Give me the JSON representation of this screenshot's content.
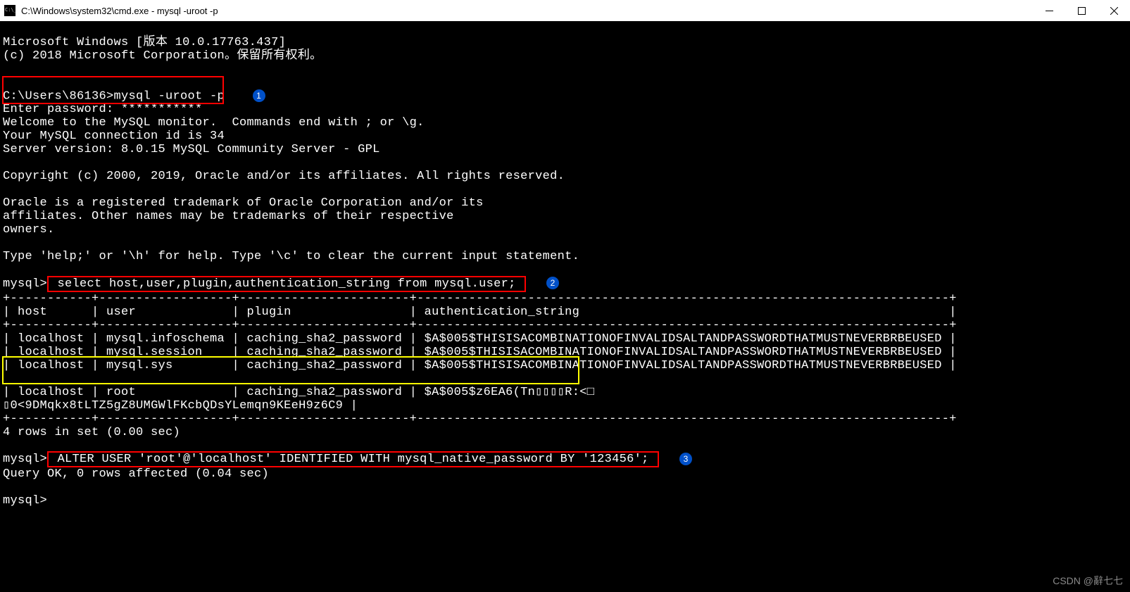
{
  "titlebar": {
    "title": "C:\\Windows\\system32\\cmd.exe - mysql  -uroot -p"
  },
  "term": {
    "winver1": "Microsoft Windows [版本 10.0.17763.437]",
    "winver2": "(c) 2018 Microsoft Corporation。保留所有权利。",
    "prompt1a": "C:\\Users\\86136>",
    "prompt1b": "mysql -uroot -p",
    "passline": "Enter password: ***********",
    "welcome1": "Welcome to the MySQL monitor.  Commands end with ; or \\g.",
    "welcome2": "Your MySQL connection id is 34",
    "welcome3": "Server version: 8.0.15 MySQL Community Server - GPL",
    "copyright": "Copyright (c) 2000, 2019, Oracle and/or its affiliates. All rights reserved.",
    "trademark1": "Oracle is a registered trademark of Oracle Corporation and/or its",
    "trademark2": "affiliates. Other names may be trademarks of their respective",
    "trademark3": "owners.",
    "help": "Type 'help;' or '\\h' for help. Type '\\c' to clear the current input statement.",
    "prompt2a": "mysql>",
    "query1": " select host,user,plugin,authentication_string from mysql.user; ",
    "tborder": "+-----------+------------------+-----------------------+------------------------------------------------------------------------+",
    "theader": "| host      | user             | plugin                | authentication_string                                                  |",
    "trow1": "| localhost | mysql.infoschema | caching_sha2_password | $A$005$THISISACOMBINATIONOFINVALIDSALTANDPASSWORDTHATMUSTNEVERBRBEUSED |",
    "trow2": "| localhost | mysql.session    | caching_sha2_password | $A$005$THISISACOMBINATIONOFINVALIDSALTANDPASSWORDTHATMUSTNEVERBRBEUSED |",
    "trow3": "| localhost | mysql.sys        | caching_sha2_password | $A$005$THISISACOMBINATIONOFINVALIDSALTANDPASSWORDTHATMUSTNEVERBRBEUSED |",
    "trow4a": "| localhost | root             | caching_sha2_password | $A$005$z6EA6(Tn▯▯▯▯R:<□",
    "trow4b": "▯0<9DMqkx8tLTZ5gZ8UMGWlFKcbQDsYLemqn9KEeH9z6C9 |",
    "rowcount": "4 rows in set (0.00 sec)",
    "prompt3a": "mysql>",
    "query2": " ALTER USER 'root'@'localhost' IDENTIFIED WITH mysql_native_password BY '123456'; ",
    "queryok": "Query OK, 0 rows affected (0.04 sec)",
    "prompt4": "mysql>"
  },
  "annotations": {
    "n1": "1",
    "n2": "2",
    "n3": "3"
  },
  "watermark": "CSDN @辭七七"
}
